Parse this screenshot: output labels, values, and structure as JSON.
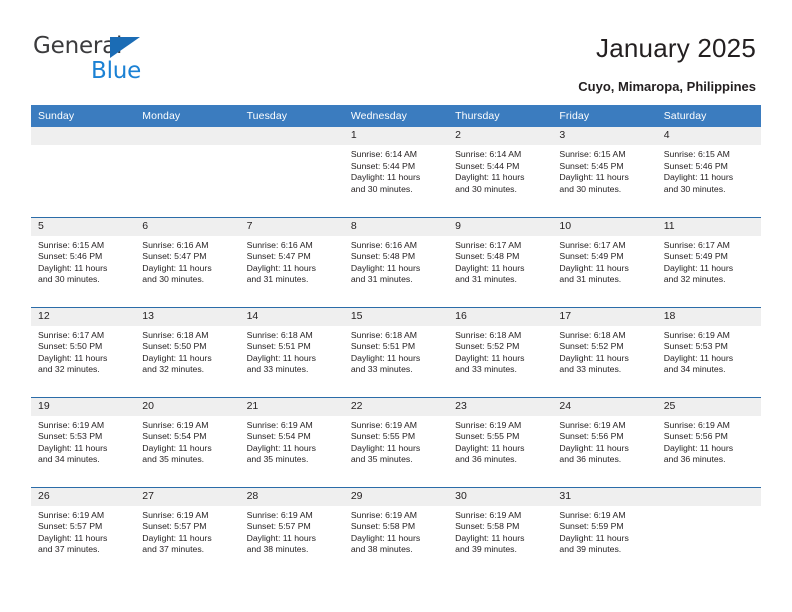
{
  "brand": {
    "name_part1": "General",
    "name_part2": "Blue",
    "triangle_color": "#1b6cb5",
    "blue_color": "#1b81d4"
  },
  "header": {
    "title": "January 2025",
    "subtitle": "Cuyo, Mimaropa, Philippines"
  },
  "theme": {
    "header_blue": "#3b7cbf",
    "row_border_blue": "#2b6ca8",
    "daynum_gray": "#efefef",
    "text": "#231f20"
  },
  "columns": [
    "Sunday",
    "Monday",
    "Tuesday",
    "Wednesday",
    "Thursday",
    "Friday",
    "Saturday"
  ],
  "labels": {
    "sunrise_prefix": "Sunrise: ",
    "sunset_prefix": "Sunset: ",
    "daylight_prefix": "Daylight: "
  },
  "weeks": [
    [
      {
        "day": "",
        "sunrise": "",
        "sunset": "",
        "daylight_a": "",
        "daylight_b": ""
      },
      {
        "day": "",
        "sunrise": "",
        "sunset": "",
        "daylight_a": "",
        "daylight_b": ""
      },
      {
        "day": "",
        "sunrise": "",
        "sunset": "",
        "daylight_a": "",
        "daylight_b": ""
      },
      {
        "day": "1",
        "sunrise": "Sunrise: 6:14 AM",
        "sunset": "Sunset: 5:44 PM",
        "daylight_a": "Daylight: 11 hours",
        "daylight_b": "and 30 minutes."
      },
      {
        "day": "2",
        "sunrise": "Sunrise: 6:14 AM",
        "sunset": "Sunset: 5:44 PM",
        "daylight_a": "Daylight: 11 hours",
        "daylight_b": "and 30 minutes."
      },
      {
        "day": "3",
        "sunrise": "Sunrise: 6:15 AM",
        "sunset": "Sunset: 5:45 PM",
        "daylight_a": "Daylight: 11 hours",
        "daylight_b": "and 30 minutes."
      },
      {
        "day": "4",
        "sunrise": "Sunrise: 6:15 AM",
        "sunset": "Sunset: 5:46 PM",
        "daylight_a": "Daylight: 11 hours",
        "daylight_b": "and 30 minutes."
      }
    ],
    [
      {
        "day": "5",
        "sunrise": "Sunrise: 6:15 AM",
        "sunset": "Sunset: 5:46 PM",
        "daylight_a": "Daylight: 11 hours",
        "daylight_b": "and 30 minutes."
      },
      {
        "day": "6",
        "sunrise": "Sunrise: 6:16 AM",
        "sunset": "Sunset: 5:47 PM",
        "daylight_a": "Daylight: 11 hours",
        "daylight_b": "and 30 minutes."
      },
      {
        "day": "7",
        "sunrise": "Sunrise: 6:16 AM",
        "sunset": "Sunset: 5:47 PM",
        "daylight_a": "Daylight: 11 hours",
        "daylight_b": "and 31 minutes."
      },
      {
        "day": "8",
        "sunrise": "Sunrise: 6:16 AM",
        "sunset": "Sunset: 5:48 PM",
        "daylight_a": "Daylight: 11 hours",
        "daylight_b": "and 31 minutes."
      },
      {
        "day": "9",
        "sunrise": "Sunrise: 6:17 AM",
        "sunset": "Sunset: 5:48 PM",
        "daylight_a": "Daylight: 11 hours",
        "daylight_b": "and 31 minutes."
      },
      {
        "day": "10",
        "sunrise": "Sunrise: 6:17 AM",
        "sunset": "Sunset: 5:49 PM",
        "daylight_a": "Daylight: 11 hours",
        "daylight_b": "and 31 minutes."
      },
      {
        "day": "11",
        "sunrise": "Sunrise: 6:17 AM",
        "sunset": "Sunset: 5:49 PM",
        "daylight_a": "Daylight: 11 hours",
        "daylight_b": "and 32 minutes."
      }
    ],
    [
      {
        "day": "12",
        "sunrise": "Sunrise: 6:17 AM",
        "sunset": "Sunset: 5:50 PM",
        "daylight_a": "Daylight: 11 hours",
        "daylight_b": "and 32 minutes."
      },
      {
        "day": "13",
        "sunrise": "Sunrise: 6:18 AM",
        "sunset": "Sunset: 5:50 PM",
        "daylight_a": "Daylight: 11 hours",
        "daylight_b": "and 32 minutes."
      },
      {
        "day": "14",
        "sunrise": "Sunrise: 6:18 AM",
        "sunset": "Sunset: 5:51 PM",
        "daylight_a": "Daylight: 11 hours",
        "daylight_b": "and 33 minutes."
      },
      {
        "day": "15",
        "sunrise": "Sunrise: 6:18 AM",
        "sunset": "Sunset: 5:51 PM",
        "daylight_a": "Daylight: 11 hours",
        "daylight_b": "and 33 minutes."
      },
      {
        "day": "16",
        "sunrise": "Sunrise: 6:18 AM",
        "sunset": "Sunset: 5:52 PM",
        "daylight_a": "Daylight: 11 hours",
        "daylight_b": "and 33 minutes."
      },
      {
        "day": "17",
        "sunrise": "Sunrise: 6:18 AM",
        "sunset": "Sunset: 5:52 PM",
        "daylight_a": "Daylight: 11 hours",
        "daylight_b": "and 33 minutes."
      },
      {
        "day": "18",
        "sunrise": "Sunrise: 6:19 AM",
        "sunset": "Sunset: 5:53 PM",
        "daylight_a": "Daylight: 11 hours",
        "daylight_b": "and 34 minutes."
      }
    ],
    [
      {
        "day": "19",
        "sunrise": "Sunrise: 6:19 AM",
        "sunset": "Sunset: 5:53 PM",
        "daylight_a": "Daylight: 11 hours",
        "daylight_b": "and 34 minutes."
      },
      {
        "day": "20",
        "sunrise": "Sunrise: 6:19 AM",
        "sunset": "Sunset: 5:54 PM",
        "daylight_a": "Daylight: 11 hours",
        "daylight_b": "and 35 minutes."
      },
      {
        "day": "21",
        "sunrise": "Sunrise: 6:19 AM",
        "sunset": "Sunset: 5:54 PM",
        "daylight_a": "Daylight: 11 hours",
        "daylight_b": "and 35 minutes."
      },
      {
        "day": "22",
        "sunrise": "Sunrise: 6:19 AM",
        "sunset": "Sunset: 5:55 PM",
        "daylight_a": "Daylight: 11 hours",
        "daylight_b": "and 35 minutes."
      },
      {
        "day": "23",
        "sunrise": "Sunrise: 6:19 AM",
        "sunset": "Sunset: 5:55 PM",
        "daylight_a": "Daylight: 11 hours",
        "daylight_b": "and 36 minutes."
      },
      {
        "day": "24",
        "sunrise": "Sunrise: 6:19 AM",
        "sunset": "Sunset: 5:56 PM",
        "daylight_a": "Daylight: 11 hours",
        "daylight_b": "and 36 minutes."
      },
      {
        "day": "25",
        "sunrise": "Sunrise: 6:19 AM",
        "sunset": "Sunset: 5:56 PM",
        "daylight_a": "Daylight: 11 hours",
        "daylight_b": "and 36 minutes."
      }
    ],
    [
      {
        "day": "26",
        "sunrise": "Sunrise: 6:19 AM",
        "sunset": "Sunset: 5:57 PM",
        "daylight_a": "Daylight: 11 hours",
        "daylight_b": "and 37 minutes."
      },
      {
        "day": "27",
        "sunrise": "Sunrise: 6:19 AM",
        "sunset": "Sunset: 5:57 PM",
        "daylight_a": "Daylight: 11 hours",
        "daylight_b": "and 37 minutes."
      },
      {
        "day": "28",
        "sunrise": "Sunrise: 6:19 AM",
        "sunset": "Sunset: 5:57 PM",
        "daylight_a": "Daylight: 11 hours",
        "daylight_b": "and 38 minutes."
      },
      {
        "day": "29",
        "sunrise": "Sunrise: 6:19 AM",
        "sunset": "Sunset: 5:58 PM",
        "daylight_a": "Daylight: 11 hours",
        "daylight_b": "and 38 minutes."
      },
      {
        "day": "30",
        "sunrise": "Sunrise: 6:19 AM",
        "sunset": "Sunset: 5:58 PM",
        "daylight_a": "Daylight: 11 hours",
        "daylight_b": "and 39 minutes."
      },
      {
        "day": "31",
        "sunrise": "Sunrise: 6:19 AM",
        "sunset": "Sunset: 5:59 PM",
        "daylight_a": "Daylight: 11 hours",
        "daylight_b": "and 39 minutes."
      },
      {
        "day": "",
        "sunrise": "",
        "sunset": "",
        "daylight_a": "",
        "daylight_b": ""
      }
    ]
  ]
}
